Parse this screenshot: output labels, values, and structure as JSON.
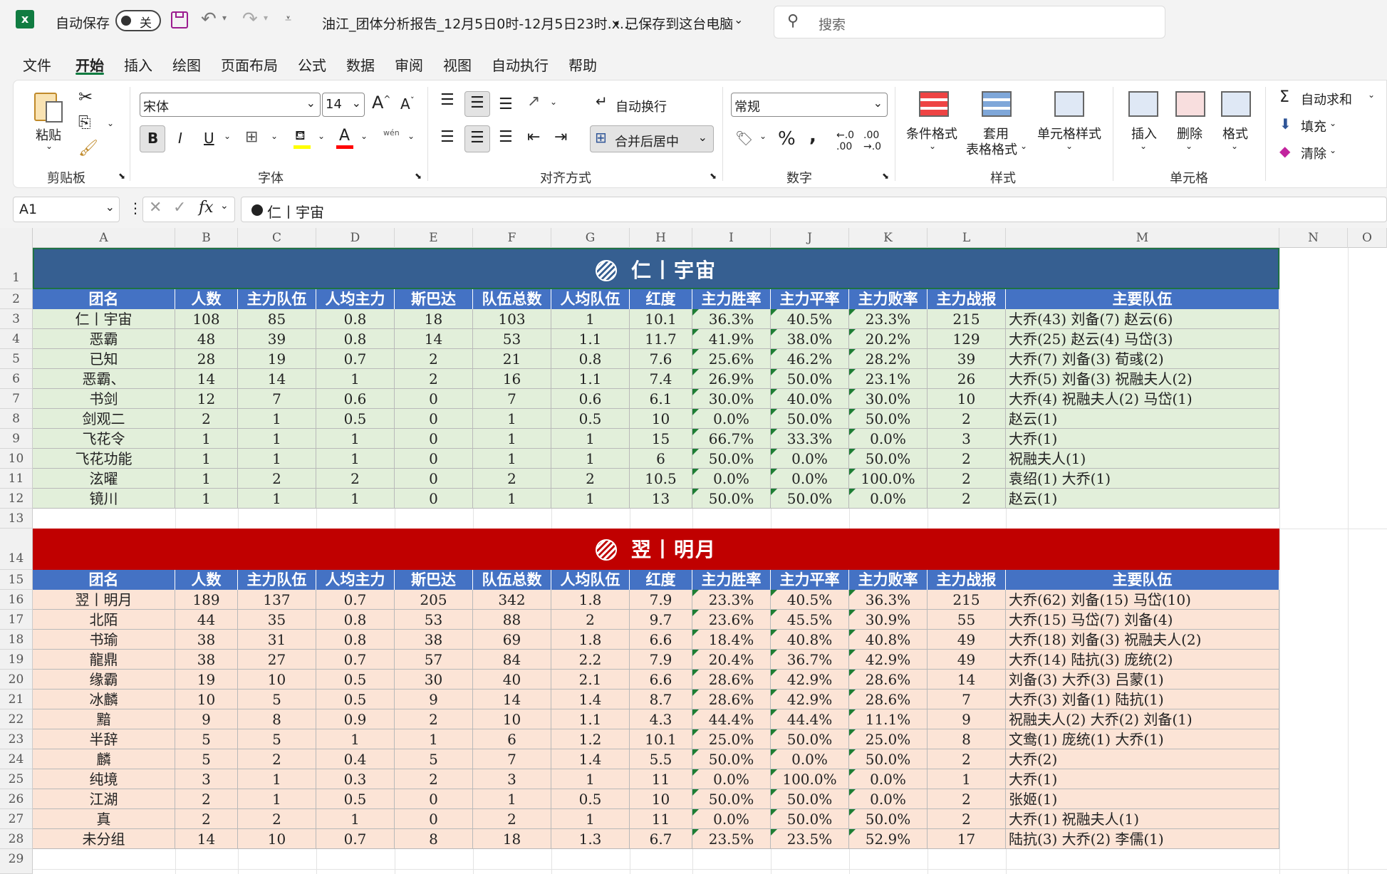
{
  "titlebar": {
    "autosave_label": "自动保存",
    "autosave_state": "关",
    "filename": "油江_团体分析报告_12月5日0时-12月5日23时.x...",
    "save_status": "• 已保存到这台电脑",
    "search_placeholder": "搜索"
  },
  "menu": [
    "文件",
    "开始",
    "插入",
    "绘图",
    "页面布局",
    "公式",
    "数据",
    "审阅",
    "视图",
    "自动执行",
    "帮助"
  ],
  "ribbon": {
    "paste_label": "粘贴",
    "clipboard_group": "剪贴板",
    "font_name": "宋体",
    "font_size": "14",
    "bold": "B",
    "italic": "I",
    "underline": "U",
    "font_group": "字体",
    "wrap_text": "自动换行",
    "merge_center": "合并后居中",
    "align_group": "对齐方式",
    "number_format": "常规",
    "number_group": "数字",
    "cond_format": "条件格式",
    "table_format_1": "套用",
    "table_format_2": "表格格式",
    "cell_style": "单元格样式",
    "styles_group": "样式",
    "insert": "插入",
    "delete": "删除",
    "format": "格式",
    "cells_group": "单元格",
    "autosum": "自动求和",
    "fill": "填充",
    "clear": "清除",
    "phonetic": "wén"
  },
  "formula": {
    "cell_ref": "A1",
    "content": "仁丨宇宙"
  },
  "columns": [
    "A",
    "B",
    "C",
    "D",
    "E",
    "F",
    "G",
    "H",
    "I",
    "J",
    "K",
    "L",
    "M",
    "N",
    "O"
  ],
  "headers": [
    "团名",
    "人数",
    "主力队伍",
    "人均主力",
    "斯巴达",
    "队伍总数",
    "人均队伍",
    "红度",
    "主力胜率",
    "主力平率",
    "主力败率",
    "主力战报",
    "主要队伍"
  ],
  "section1": {
    "title": "仁丨宇宙",
    "rows": [
      [
        "仁丨宇宙",
        "108",
        "85",
        "0.8",
        "18",
        "103",
        "1",
        "10.1",
        "36.3%",
        "40.5%",
        "23.3%",
        "215",
        "大乔(43) 刘备(7) 赵云(6)"
      ],
      [
        "恶霸",
        "48",
        "39",
        "0.8",
        "14",
        "53",
        "1.1",
        "11.7",
        "41.9%",
        "38.0%",
        "20.2%",
        "129",
        "大乔(25) 赵云(4) 马岱(3)"
      ],
      [
        "已知",
        "28",
        "19",
        "0.7",
        "2",
        "21",
        "0.8",
        "7.6",
        "25.6%",
        "46.2%",
        "28.2%",
        "39",
        "大乔(7) 刘备(3) 荀彧(2)"
      ],
      [
        "恶霸、",
        "14",
        "14",
        "1",
        "2",
        "16",
        "1.1",
        "7.4",
        "26.9%",
        "50.0%",
        "23.1%",
        "26",
        "大乔(5) 刘备(3) 祝融夫人(2)"
      ],
      [
        "书剑",
        "12",
        "7",
        "0.6",
        "0",
        "7",
        "0.6",
        "6.1",
        "30.0%",
        "40.0%",
        "30.0%",
        "10",
        "大乔(4) 祝融夫人(2) 马岱(1)"
      ],
      [
        "剑观二",
        "2",
        "1",
        "0.5",
        "0",
        "1",
        "0.5",
        "10",
        "0.0%",
        "50.0%",
        "50.0%",
        "2",
        "赵云(1)"
      ],
      [
        "飞花令",
        "1",
        "1",
        "1",
        "0",
        "1",
        "1",
        "15",
        "66.7%",
        "33.3%",
        "0.0%",
        "3",
        "大乔(1)"
      ],
      [
        "飞花功能",
        "1",
        "1",
        "1",
        "0",
        "1",
        "1",
        "6",
        "50.0%",
        "0.0%",
        "50.0%",
        "2",
        "祝融夫人(1)"
      ],
      [
        "泫曜",
        "1",
        "2",
        "2",
        "0",
        "2",
        "2",
        "10.5",
        "0.0%",
        "0.0%",
        "100.0%",
        "2",
        "袁绍(1) 大乔(1)"
      ],
      [
        "镜川",
        "1",
        "1",
        "1",
        "0",
        "1",
        "1",
        "13",
        "50.0%",
        "50.0%",
        "0.0%",
        "2",
        "赵云(1)"
      ]
    ]
  },
  "section2": {
    "title": "翌丨明月",
    "rows": [
      [
        "翌丨明月",
        "189",
        "137",
        "0.7",
        "205",
        "342",
        "1.8",
        "7.9",
        "23.3%",
        "40.5%",
        "36.3%",
        "215",
        "大乔(62) 刘备(15) 马岱(10)"
      ],
      [
        "北陌",
        "44",
        "35",
        "0.8",
        "53",
        "88",
        "2",
        "9.7",
        "23.6%",
        "45.5%",
        "30.9%",
        "55",
        "大乔(15) 马岱(7) 刘备(4)"
      ],
      [
        "书瑜",
        "38",
        "31",
        "0.8",
        "38",
        "69",
        "1.8",
        "6.6",
        "18.4%",
        "40.8%",
        "40.8%",
        "49",
        "大乔(18) 刘备(3) 祝融夫人(2)"
      ],
      [
        "龍鼎",
        "38",
        "27",
        "0.7",
        "57",
        "84",
        "2.2",
        "7.9",
        "20.4%",
        "36.7%",
        "42.9%",
        "49",
        "大乔(14) 陆抗(3) 庞统(2)"
      ],
      [
        "缘霸",
        "19",
        "10",
        "0.5",
        "30",
        "40",
        "2.1",
        "6.6",
        "28.6%",
        "42.9%",
        "28.6%",
        "14",
        "刘备(3) 大乔(3) 吕蒙(1)"
      ],
      [
        "冰麟",
        "10",
        "5",
        "0.5",
        "9",
        "14",
        "1.4",
        "8.7",
        "28.6%",
        "42.9%",
        "28.6%",
        "7",
        "大乔(3) 刘备(1) 陆抗(1)"
      ],
      [
        "黯",
        "9",
        "8",
        "0.9",
        "2",
        "10",
        "1.1",
        "4.3",
        "44.4%",
        "44.4%",
        "11.1%",
        "9",
        "祝融夫人(2) 大乔(2) 刘备(1)"
      ],
      [
        "半辞",
        "5",
        "5",
        "1",
        "1",
        "6",
        "1.2",
        "10.1",
        "25.0%",
        "50.0%",
        "25.0%",
        "8",
        "文鸯(1) 庞统(1) 大乔(1)"
      ],
      [
        "麟",
        "5",
        "2",
        "0.4",
        "5",
        "7",
        "1.4",
        "5.5",
        "50.0%",
        "0.0%",
        "50.0%",
        "2",
        "大乔(2)"
      ],
      [
        "纯境",
        "3",
        "1",
        "0.3",
        "2",
        "3",
        "1",
        "11",
        "0.0%",
        "100.0%",
        "0.0%",
        "1",
        "大乔(1)"
      ],
      [
        "江湖",
        "2",
        "1",
        "0.5",
        "0",
        "1",
        "0.5",
        "10",
        "50.0%",
        "50.0%",
        "0.0%",
        "2",
        "张姬(1)"
      ],
      [
        "真",
        "2",
        "2",
        "1",
        "0",
        "2",
        "1",
        "11",
        "0.0%",
        "50.0%",
        "50.0%",
        "2",
        "大乔(1) 祝融夫人(1)"
      ],
      [
        "未分组",
        "14",
        "10",
        "0.7",
        "8",
        "18",
        "1.3",
        "6.7",
        "23.5%",
        "23.5%",
        "52.9%",
        "17",
        "陆抗(3) 大乔(2) 李儒(1)"
      ]
    ]
  },
  "row_numbers": [
    "1",
    "2",
    "3",
    "4",
    "5",
    "6",
    "7",
    "8",
    "9",
    "10",
    "11",
    "12",
    "13",
    "14",
    "15",
    "16",
    "17",
    "18",
    "19",
    "20",
    "21",
    "22",
    "23",
    "24",
    "25",
    "26",
    "27",
    "28",
    "29"
  ],
  "colors": {
    "section1_banner": "#365f91",
    "section2_banner": "#c00000",
    "header_bg": "#4472c4",
    "section1_row": "#e2efda",
    "section2_row": "#fce4d6"
  }
}
